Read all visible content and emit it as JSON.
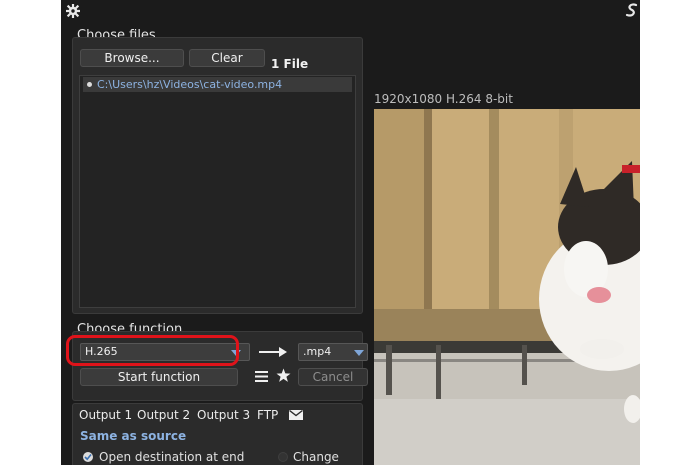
{
  "icons": {
    "settings": "gear-icon",
    "app_logo": "app-logo-icon",
    "list": "list-icon",
    "favorite": "star-icon",
    "arrow": "arrow-right-icon",
    "email": "envelope-icon"
  },
  "files": {
    "title": "Choose files",
    "browse_label": "Browse...",
    "clear_label": "Clear",
    "count_text": "1 File",
    "items": [
      {
        "path": "C:\\Users\\hz\\Videos\\cat-video.mp4"
      }
    ]
  },
  "function": {
    "title": "Choose function",
    "codec_value": "H.265",
    "container_value": ".mp4",
    "start_label": "Start function",
    "cancel_label": "Cancel"
  },
  "output": {
    "tabs": [
      {
        "label": "Output 1"
      },
      {
        "label": "Output 2"
      },
      {
        "label": "Output 3"
      },
      {
        "label": "FTP"
      }
    ],
    "same_as_source_label": "Same as source",
    "open_destination_label": "Open destination at end",
    "change_label": "Change"
  },
  "preview": {
    "video_info": "1920x1080 H.264 8-bit"
  },
  "colors": {
    "app_bg": "#1b1b1b",
    "panel_bg": "#2b2b2b",
    "accent_blue": "#8db3e2",
    "highlight_red": "#e0131a"
  }
}
